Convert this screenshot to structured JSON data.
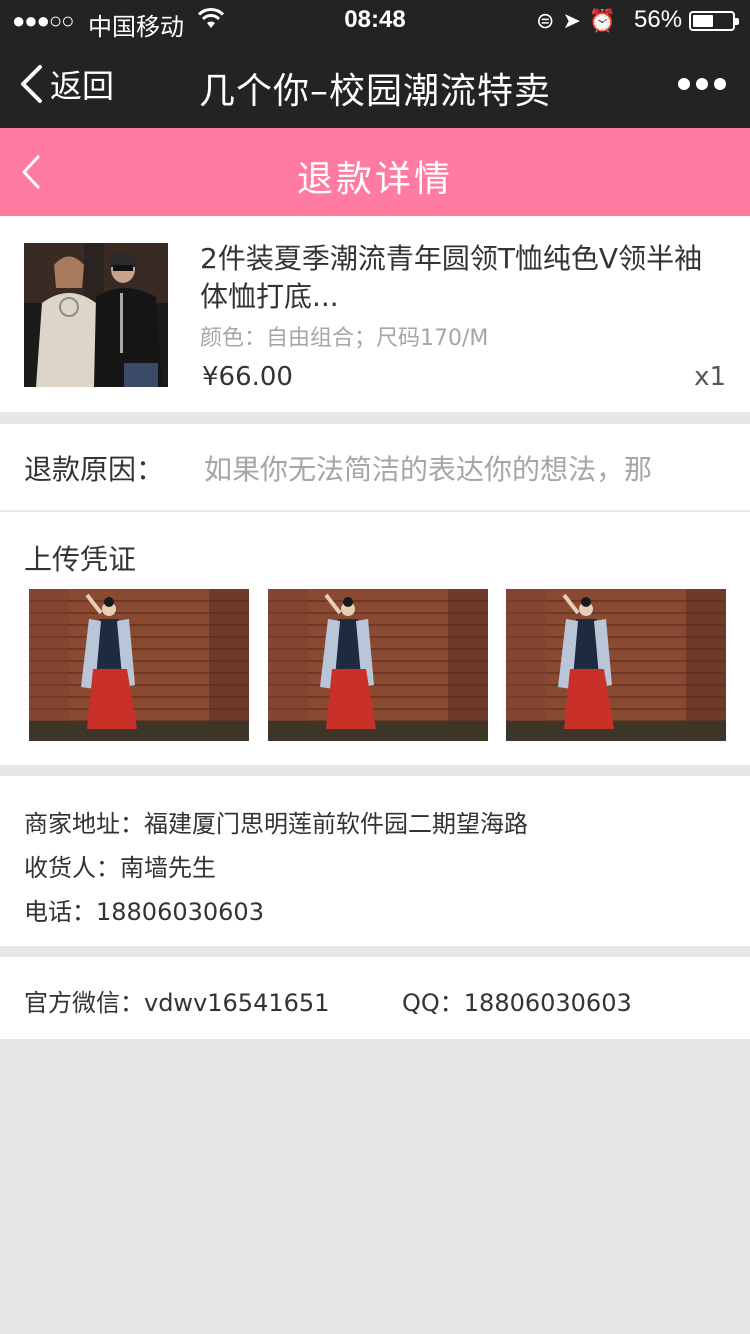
{
  "status_bar": {
    "signal": "●●●○○",
    "carrier": "中国移动",
    "time": "08:48",
    "battery_percent": "56%",
    "battery_level": 0.56
  },
  "nav": {
    "back_label": "返回",
    "title": "几个你–校园潮流特卖"
  },
  "header": {
    "title": "退款详情",
    "accent_color": "#ff7ba1"
  },
  "product": {
    "name": "2件装夏季潮流青年圆领T恤纯色V领半袖体恤打底...",
    "spec": "颜色：自由组合；尺码170/M",
    "price": "¥66.00",
    "quantity": "x1"
  },
  "refund_reason": {
    "label": "退款原因：",
    "value": "如果你无法简洁的表达你的想法，那"
  },
  "proof": {
    "title": "上传凭证"
  },
  "address": {
    "merchant_address": "商家地址：福建厦门思明莲前软件园二期望海路",
    "receiver": "收货人：南墙先生",
    "phone": "电话：18806030603"
  },
  "contact": {
    "wechat": "官方微信：vdwv16541651",
    "qq": "QQ：18806030603"
  }
}
